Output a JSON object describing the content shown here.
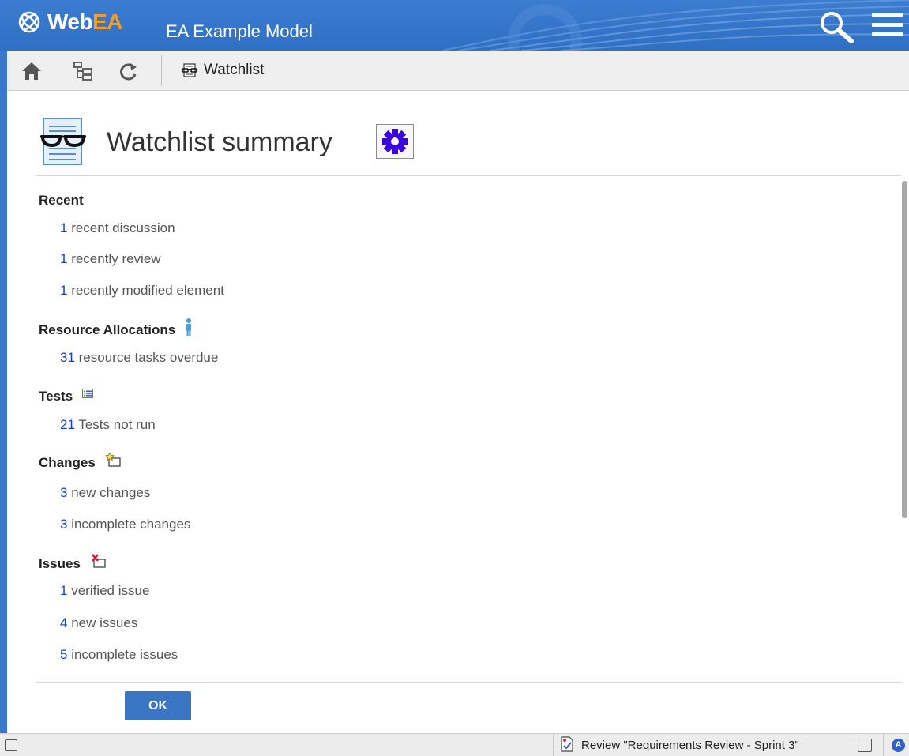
{
  "header": {
    "logo_web": "Web",
    "logo_ea": "EA",
    "model_title": "EA Example Model",
    "icons": [
      "webea-logo-icon",
      "search-icon",
      "hamburger-menu-icon"
    ]
  },
  "toolbar": {
    "icons": [
      "home-icon",
      "tree-browser-icon",
      "refresh-icon"
    ],
    "page_label": "Watchlist",
    "page_icon": "watchlist-icon"
  },
  "page": {
    "title": "Watchlist summary",
    "settings_icon": "gear-icon"
  },
  "sections": {
    "recent": {
      "heading": "Recent",
      "items": [
        {
          "count": "1",
          "text": " recent discussion"
        },
        {
          "count": "1",
          "text": " recently review"
        },
        {
          "count": "1",
          "text": " recently modified element"
        }
      ]
    },
    "resources": {
      "heading": "Resource Allocations",
      "icon": "person-icon",
      "items": [
        {
          "count": "31",
          "text": " resource tasks overdue"
        }
      ]
    },
    "tests": {
      "heading": "Tests",
      "icon": "test-list-icon",
      "items": [
        {
          "count": "21",
          "text": " Tests not run"
        }
      ]
    },
    "changes": {
      "heading": "Changes",
      "icon": "change-icon",
      "items": [
        {
          "count": "3",
          "text": " new changes"
        },
        {
          "count": "3",
          "text": " incomplete changes"
        }
      ]
    },
    "issues": {
      "heading": "Issues",
      "icon": "issue-icon",
      "items": [
        {
          "count": "1",
          "text": " verified issue"
        },
        {
          "count": "4",
          "text": " new issues"
        },
        {
          "count": "5",
          "text": " incomplete issues"
        }
      ]
    }
  },
  "buttons": {
    "ok": "OK"
  },
  "statusbar": {
    "review_text": "Review \"Requirements Review - Sprint 3\"",
    "a_badge": "A"
  },
  "colors": {
    "header_blue": "#3d7dd0",
    "link_blue": "#1a3fc7",
    "ok_button": "#3a76c4",
    "logo_orange": "#ff9a1a"
  }
}
